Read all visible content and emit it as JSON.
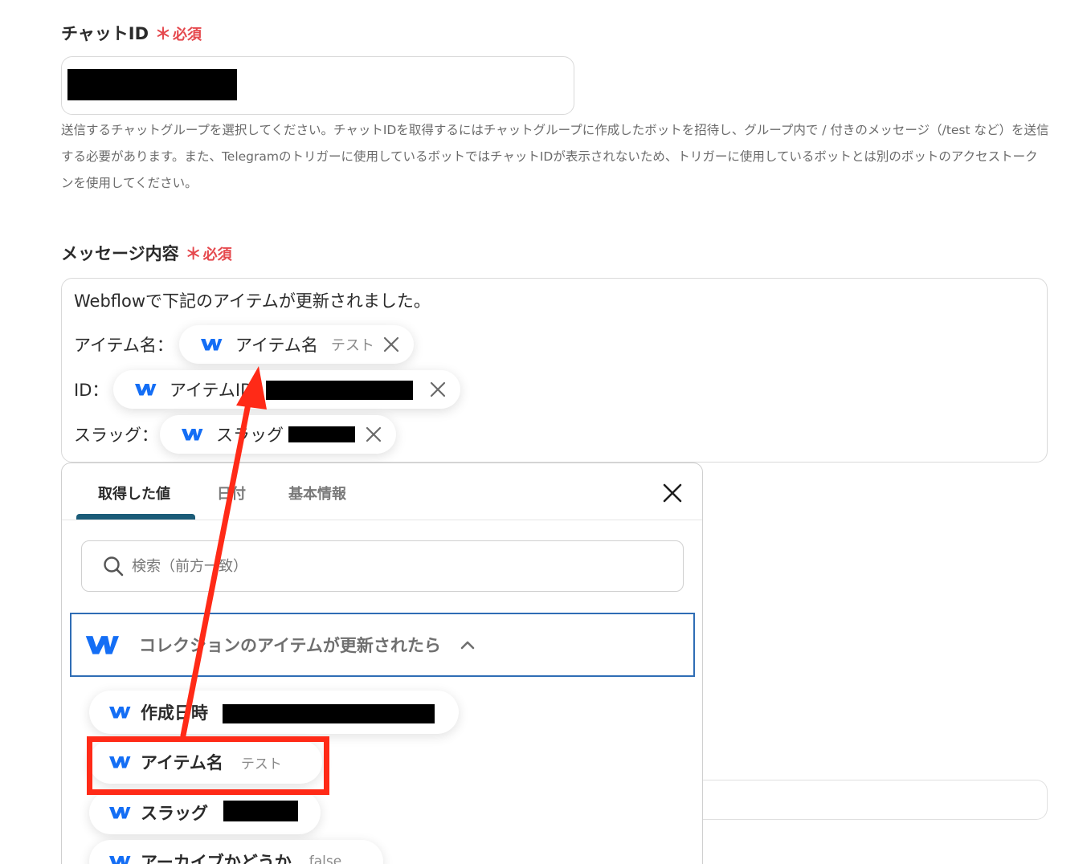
{
  "chat_id": {
    "label": "チャットID",
    "required_mark": "＊",
    "required_text": "必須",
    "help": "送信するチャットグループを選択してください。チャットIDを取得するにはチャットグループに作成したボットを招待し、グループ内で / 付きのメッセージ（/test など）を送信する必要があります。また、Telegramのトリガーに使用しているボットではチャットIDが表示されないため、トリガーに使用しているボットとは別のボットのアクセストークンを使用してください。"
  },
  "message": {
    "label": "メッセージ内容",
    "required_mark": "＊",
    "required_text": "必須",
    "intro": "Webflowで下記のアイテムが更新されました。",
    "rows": [
      {
        "label": "アイテム名：",
        "chip_name": "アイテム名",
        "chip_value": "テスト"
      },
      {
        "label": "ID：",
        "chip_name": "アイテムID",
        "chip_value": ""
      },
      {
        "label": "スラッグ：",
        "chip_name": "スラッグ",
        "chip_value": ""
      }
    ]
  },
  "panel": {
    "tabs": [
      "取得した値",
      "日付",
      "基本情報"
    ],
    "active_tab": 0,
    "search_placeholder": "検索（前方一致）",
    "group_title": "コレクションのアイテムが更新されたら",
    "options": [
      {
        "name": "作成日時",
        "value": ""
      },
      {
        "name": "アイテム名",
        "value": "テスト"
      },
      {
        "name": "スラッグ",
        "value": ""
      },
      {
        "name": "アーカイブかどうか",
        "value": "false"
      }
    ]
  },
  "colors": {
    "required": "#e5484d",
    "webflow_blue": "#146ef5",
    "highlight_red": "#ff2a17",
    "tab_underline": "#1b5c78",
    "group_border": "#2f6db5"
  },
  "icons": {
    "webflow": "webflow-logo-icon",
    "remove": "close-icon",
    "search": "search-icon",
    "collapse": "chevron-up-icon"
  }
}
